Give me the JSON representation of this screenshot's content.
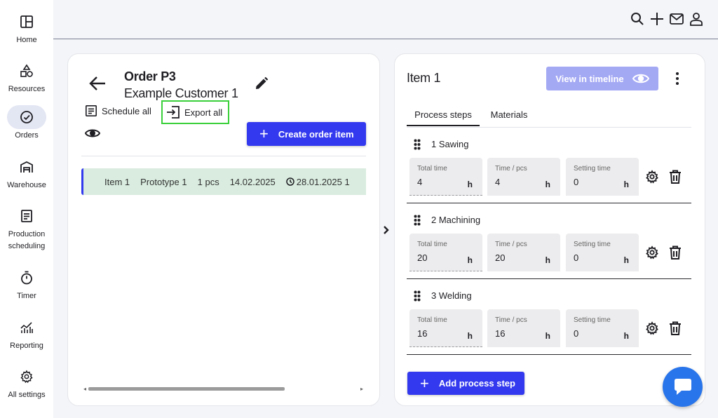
{
  "sidebar": {
    "items": [
      {
        "label": "Home",
        "icon": "home-icon"
      },
      {
        "label": "Resources",
        "icon": "shapes-icon"
      },
      {
        "label": "Orders",
        "icon": "check-circle-icon",
        "active": true
      },
      {
        "label": "Warehouse",
        "icon": "warehouse-icon"
      },
      {
        "label": "Production scheduling",
        "icon": "schedule-icon"
      },
      {
        "label": "Timer",
        "icon": "stopwatch-icon"
      },
      {
        "label": "Reporting",
        "icon": "chart-icon"
      },
      {
        "label": "All settings",
        "icon": "gear-icon"
      }
    ]
  },
  "order": {
    "title": "Order P3",
    "customer": "Example Customer 1",
    "schedule_all": "Schedule all",
    "export_all": "Export all",
    "create_item": "Create order item",
    "items": [
      {
        "name": "Item 1",
        "product": "Prototype 1",
        "quantity": "1 pcs",
        "date": "14.02.2025",
        "due": "28.01.2025 1"
      }
    ]
  },
  "item": {
    "title": "Item 1",
    "view_timeline": "View in timeline",
    "tabs": {
      "process_steps": "Process steps",
      "materials": "Materials"
    },
    "field_labels": {
      "total": "Total time",
      "per_piece": "Time / pcs",
      "setting": "Setting time"
    },
    "unit": "h",
    "steps": [
      {
        "name": "1 Sawing",
        "total": "4",
        "per_piece": "4",
        "setting": "0"
      },
      {
        "name": "2 Machining",
        "total": "20",
        "per_piece": "20",
        "setting": "0"
      },
      {
        "name": "3 Welding",
        "total": "16",
        "per_piece": "16",
        "setting": "0"
      }
    ],
    "add_step": "Add process step"
  },
  "colors": {
    "primary": "#3339ee",
    "primary_light": "#a4a9f4",
    "row_highlight": "#d9ecdf",
    "highlight_border": "#3ad03a",
    "chat": "#2874ea"
  }
}
